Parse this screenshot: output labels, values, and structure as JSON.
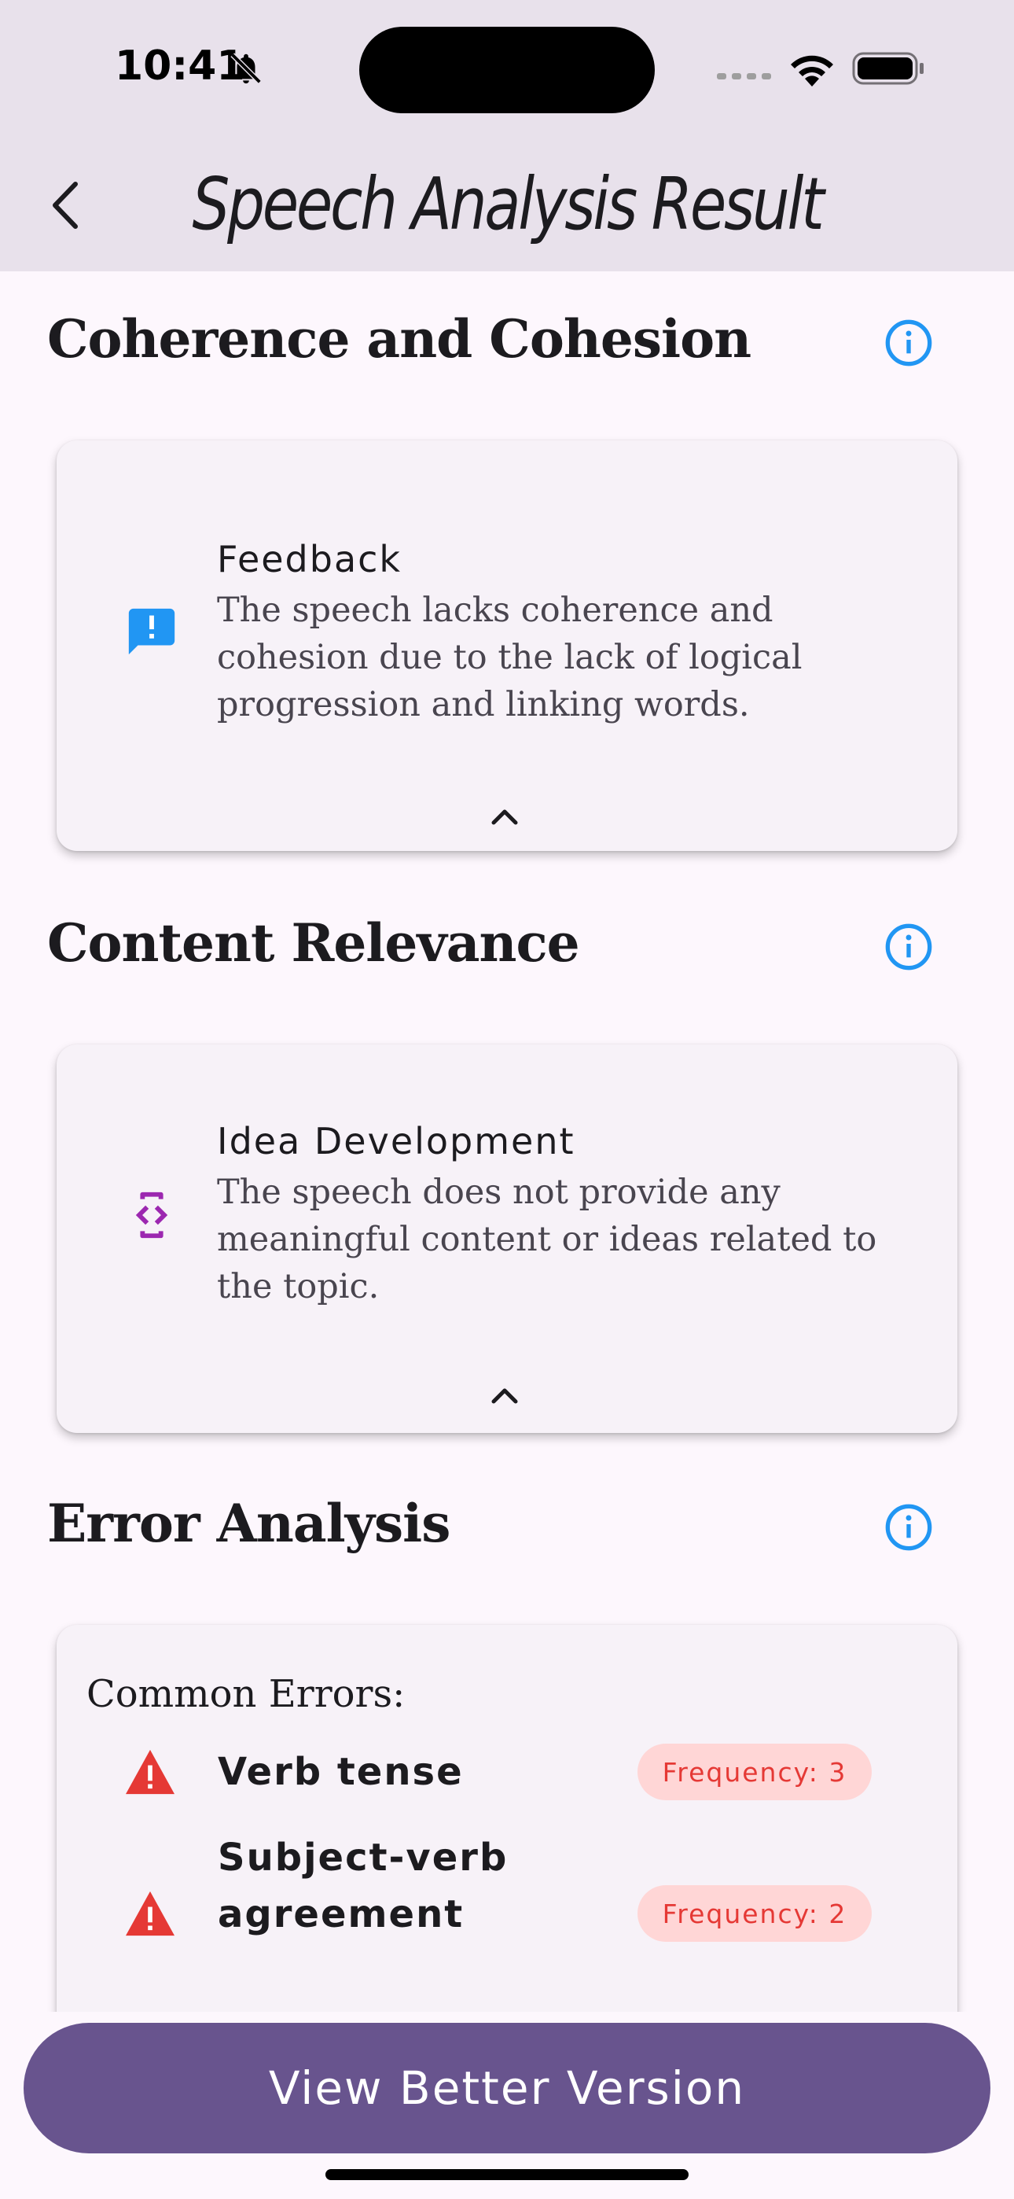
{
  "status_bar": {
    "time": "10:41"
  },
  "app_bar": {
    "title": "Speech Analysis Result"
  },
  "sections": {
    "coherence": {
      "title": "Coherence and Cohesion",
      "card": {
        "heading": "Feedback",
        "body": "The speech lacks coherence and cohesion due to the lack of logical progression and linking words.",
        "icon": "feedback-icon",
        "icon_color": "#2196F3"
      }
    },
    "content": {
      "title": "Content Relevance",
      "card": {
        "heading": "Idea Development",
        "body": "The speech does not provide any meaningful content or ideas related to the topic.",
        "icon": "developer-mode-icon",
        "icon_color": "#9C27B0"
      }
    },
    "errors": {
      "title": "Error Analysis",
      "subtitle": "Common Errors:",
      "items": [
        {
          "label": "Verb tense",
          "frequency": "Frequency: 3"
        },
        {
          "label": "Subject-verb agreement",
          "frequency": "Frequency: 2"
        }
      ]
    }
  },
  "cta": {
    "label": "View Better Version"
  },
  "colors": {
    "accent": "#68548E",
    "info": "#2196F3",
    "warning": "#E53935",
    "badge_bg": "#FFD6D6",
    "app_bar": "#E8E1EB",
    "background": "#FDF7FD"
  }
}
